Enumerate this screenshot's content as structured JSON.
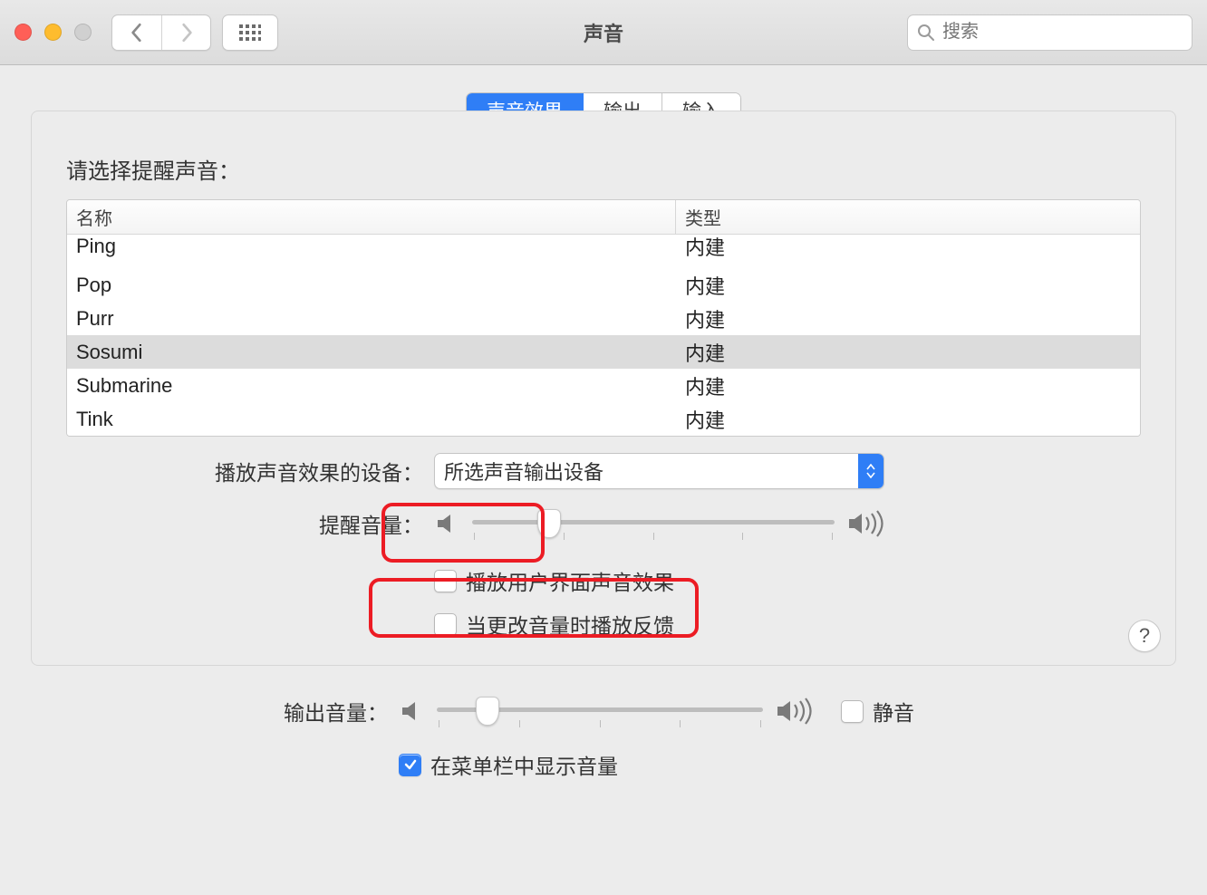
{
  "window": {
    "title": "声音"
  },
  "search": {
    "placeholder": "搜索"
  },
  "tabs": [
    {
      "label": "声音效果",
      "active": true
    },
    {
      "label": "输出",
      "active": false
    },
    {
      "label": "输入",
      "active": false
    }
  ],
  "panel": {
    "select_label": "请选择提醒声音：",
    "table": {
      "col_name": "名称",
      "col_type": "类型",
      "rows": [
        {
          "name": "Ping",
          "type": "内建",
          "selected": false
        },
        {
          "name": "Pop",
          "type": "内建",
          "selected": false
        },
        {
          "name": "Purr",
          "type": "内建",
          "selected": false
        },
        {
          "name": "Sosumi",
          "type": "内建",
          "selected": true
        },
        {
          "name": "Submarine",
          "type": "内建",
          "selected": false
        },
        {
          "name": "Tink",
          "type": "内建",
          "selected": false
        }
      ]
    },
    "device_label": "播放声音效果的设备：",
    "device_value": "所选声音输出设备",
    "alert_volume_label": "提醒音量：",
    "alert_volume_percent": 18,
    "cb_ui_sounds": "播放用户界面声音效果",
    "cb_ui_sounds_checked": false,
    "cb_feedback": "当更改音量时播放反馈",
    "cb_feedback_checked": false
  },
  "output": {
    "volume_label": "输出音量：",
    "volume_percent": 12,
    "mute_label": "静音",
    "mute_checked": false,
    "menubar_label": "在菜单栏中显示音量",
    "menubar_checked": true
  },
  "help": "?"
}
